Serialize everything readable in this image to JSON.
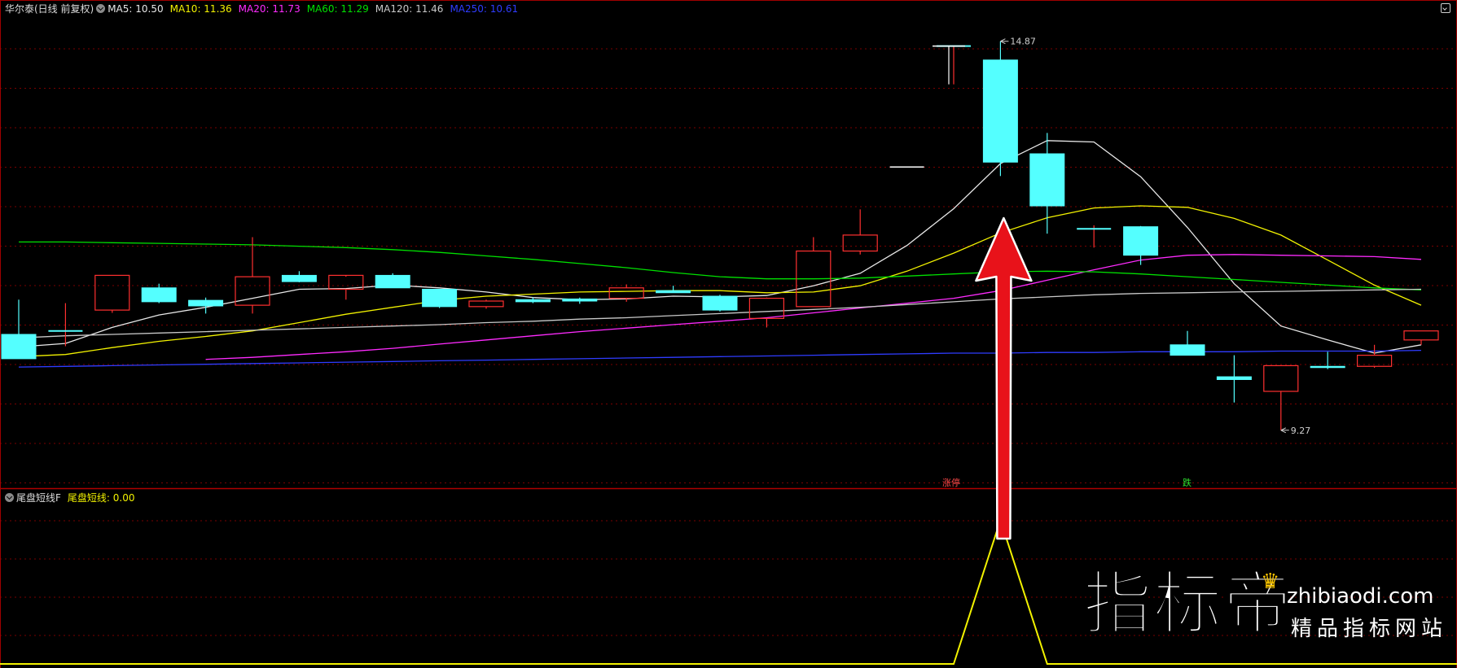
{
  "header": {
    "stock_name": "华尔泰(日线 前复权)",
    "ma_labels": [
      {
        "text": "MA5: 10.50",
        "color": "#e8e8e8"
      },
      {
        "text": "MA10: 11.36",
        "color": "#f2f200"
      },
      {
        "text": "MA20: 11.73",
        "color": "#ff2bff"
      },
      {
        "text": "MA60: 11.29",
        "color": "#00e000"
      },
      {
        "text": "MA120: 11.46",
        "color": "#c8c8c8"
      },
      {
        "text": "MA250: 10.61",
        "color": "#2f3cff"
      }
    ]
  },
  "sub_header": {
    "indicator_name": "尾盘短线F",
    "value_label": "尾盘短线: 0.00",
    "value_color": "#f2f200"
  },
  "watermark": {
    "big": "指标帝",
    "url": "zhibiaodi.com",
    "slogan": "精品指标网站",
    "crown": "♛"
  },
  "chart_data": [
    {
      "type": "candlestick",
      "ylim": [
        8.6,
        15.3
      ],
      "grid": true,
      "candles": [
        {
          "o": 10.65,
          "h": 11.15,
          "l": 10.32,
          "c": 10.3
        },
        {
          "o": 10.7,
          "h": 11.1,
          "l": 10.48,
          "c": 10.7
        },
        {
          "o": 11.0,
          "h": 11.5,
          "l": 10.96,
          "c": 11.5
        },
        {
          "o": 11.32,
          "h": 11.38,
          "l": 11.1,
          "c": 11.12
        },
        {
          "o": 11.14,
          "h": 11.18,
          "l": 10.95,
          "c": 11.06
        },
        {
          "o": 11.07,
          "h": 12.05,
          "l": 10.95,
          "c": 11.48
        },
        {
          "o": 11.5,
          "h": 11.56,
          "l": 11.4,
          "c": 11.41
        },
        {
          "o": 11.3,
          "h": 11.48,
          "l": 11.15,
          "c": 11.5
        },
        {
          "o": 11.5,
          "h": 11.53,
          "l": 11.32,
          "c": 11.32
        },
        {
          "o": 11.3,
          "h": 11.3,
          "l": 11.03,
          "c": 11.05
        },
        {
          "o": 11.05,
          "h": 11.15,
          "l": 11.02,
          "c": 11.13
        },
        {
          "o": 11.15,
          "h": 11.18,
          "l": 11.1,
          "c": 11.12
        },
        {
          "o": 11.16,
          "h": 11.18,
          "l": 11.09,
          "c": 11.13
        },
        {
          "o": 11.17,
          "h": 11.37,
          "l": 11.12,
          "c": 11.32
        },
        {
          "o": 11.28,
          "h": 11.35,
          "l": 11.25,
          "c": 11.25
        },
        {
          "o": 11.2,
          "h": 11.22,
          "l": 10.98,
          "c": 11.0
        },
        {
          "o": 10.88,
          "h": 11.18,
          "l": 10.75,
          "c": 11.17
        },
        {
          "o": 11.05,
          "h": 12.05,
          "l": 11.05,
          "c": 11.85
        },
        {
          "o": 11.85,
          "h": 12.45,
          "l": 11.8,
          "c": 12.08
        },
        {
          "o": 13.06,
          "h": 13.06,
          "l": 13.06,
          "c": 13.06
        },
        {
          "o": 14.8,
          "h": 14.8,
          "l": 14.25,
          "c": 14.8
        },
        {
          "o": 14.6,
          "h": 14.87,
          "l": 12.93,
          "c": 13.13
        },
        {
          "o": 13.25,
          "h": 13.55,
          "l": 12.1,
          "c": 12.5
        },
        {
          "o": 12.17,
          "h": 12.22,
          "l": 11.9,
          "c": 12.17
        },
        {
          "o": 12.2,
          "h": 12.21,
          "l": 11.65,
          "c": 11.79
        },
        {
          "o": 10.5,
          "h": 10.7,
          "l": 10.35,
          "c": 10.35
        },
        {
          "o": 10.04,
          "h": 10.35,
          "l": 9.67,
          "c": 10.0
        },
        {
          "o": 9.83,
          "h": 10.2,
          "l": 9.27,
          "c": 10.2
        },
        {
          "o": 10.19,
          "h": 10.4,
          "l": 10.15,
          "c": 10.18
        },
        {
          "o": 10.19,
          "h": 10.5,
          "l": 10.17,
          "c": 10.35
        },
        {
          "o": 10.57,
          "h": 10.7,
          "l": 10.5,
          "c": 10.7
        }
      ],
      "ma_lines": [
        {
          "label": "MA5",
          "color": "#e8e8e8",
          "values": [
            10.47,
            10.52,
            10.75,
            10.93,
            11.04,
            11.17,
            11.3,
            11.31,
            11.36,
            11.32,
            11.26,
            11.18,
            11.15,
            11.16,
            11.2,
            11.19,
            11.21,
            11.35,
            11.53,
            11.93,
            12.46,
            13.11,
            13.44,
            13.42,
            12.92,
            12.19,
            11.38,
            10.77,
            10.57,
            10.38,
            10.5
          ]
        },
        {
          "label": "MA10",
          "color": "#f2f200",
          "values": [
            10.33,
            10.36,
            10.46,
            10.55,
            10.62,
            10.7,
            10.82,
            10.94,
            11.04,
            11.14,
            11.2,
            11.23,
            11.26,
            11.27,
            11.28,
            11.28,
            11.25,
            11.26,
            11.35,
            11.56,
            11.82,
            12.11,
            12.33,
            12.47,
            12.5,
            12.48,
            12.32,
            12.08,
            11.72,
            11.36,
            11.07
          ]
        },
        {
          "label": "MA20",
          "color": "#ff2bff",
          "values": [
            10.29,
            10.32,
            10.36,
            10.4,
            10.45,
            10.51,
            10.57,
            10.63,
            10.69,
            10.74,
            10.79,
            10.84,
            10.89,
            10.96,
            11.03,
            11.1,
            11.17,
            11.28,
            11.43,
            11.58,
            11.72,
            11.79,
            11.8,
            11.79,
            11.78,
            11.77,
            11.73
          ]
        },
        {
          "label": "MA60",
          "color": "#00e000",
          "values": [
            11.98,
            11.98,
            11.97,
            11.96,
            11.95,
            11.94,
            11.92,
            11.9,
            11.87,
            11.83,
            11.78,
            11.73,
            11.67,
            11.61,
            11.54,
            11.48,
            11.45,
            11.45,
            11.46,
            11.49,
            11.52,
            11.55,
            11.56,
            11.55,
            11.52,
            11.48,
            11.44,
            11.4,
            11.36,
            11.32,
            11.29
          ]
        },
        {
          "label": "MA120",
          "color": "#c8c8c8",
          "values": [
            10.6,
            10.63,
            10.65,
            10.67,
            10.69,
            10.71,
            10.73,
            10.75,
            10.77,
            10.79,
            10.82,
            10.84,
            10.87,
            10.89,
            10.92,
            10.95,
            10.98,
            11.01,
            11.04,
            11.08,
            11.12,
            11.16,
            11.19,
            11.22,
            11.24,
            11.25,
            11.26,
            11.27,
            11.28,
            11.29,
            11.3
          ]
        },
        {
          "label": "MA250",
          "color": "#2f3cff",
          "values": [
            10.18,
            10.19,
            10.2,
            10.21,
            10.22,
            10.23,
            10.24,
            10.25,
            10.26,
            10.27,
            10.28,
            10.29,
            10.3,
            10.31,
            10.32,
            10.33,
            10.34,
            10.35,
            10.36,
            10.37,
            10.38,
            10.38,
            10.39,
            10.39,
            10.4,
            10.4,
            10.4,
            10.41,
            10.41,
            10.41,
            10.42
          ]
        }
      ],
      "annotations": [
        {
          "text": "14.87",
          "type": "high"
        },
        {
          "text": "9.27",
          "type": "low"
        },
        {
          "text": "涨停",
          "color": "#ff4a4a"
        },
        {
          "text": "跌",
          "color": "#2ee02e"
        }
      ]
    },
    {
      "type": "line",
      "series": [
        {
          "color": "#f2f200",
          "values": [
            0,
            0,
            0,
            0,
            0,
            0,
            0,
            0,
            0,
            0,
            0,
            0,
            0,
            0,
            0,
            0,
            0,
            0,
            0,
            0,
            0,
            1,
            0,
            0,
            0,
            0,
            0,
            0,
            0,
            0,
            0
          ]
        }
      ],
      "ylim": [
        0,
        1.12
      ]
    }
  ]
}
